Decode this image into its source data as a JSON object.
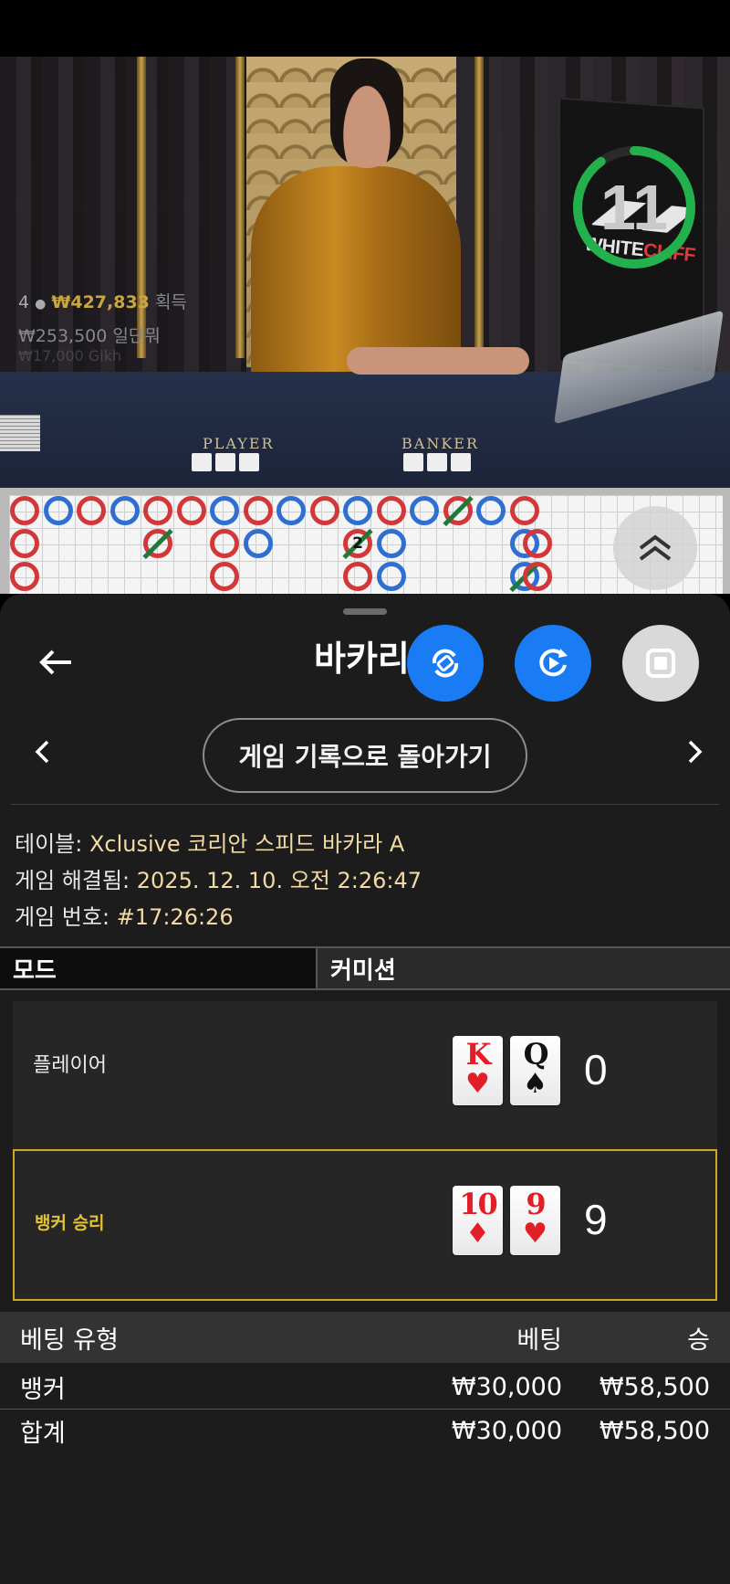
{
  "video": {
    "timer": "11",
    "timer_progress": 0.9,
    "brand_white": "WHITE",
    "brand_red": "CLIFF",
    "stats": {
      "players": "4",
      "won_amount": "₩427,833",
      "won_label": "획득",
      "bet_amount": "₩253,500",
      "bet_label": "일단뭐",
      "faded_line": "₩17,000 Gikh"
    },
    "label_player": "PLAYER",
    "label_banker": "BANKER"
  },
  "roadmap": {
    "colors": {
      "banker": "#d2383a",
      "player": "#2e6fd1",
      "tie": "#1f7a3a"
    },
    "tie_count": "2"
  },
  "sheet": {
    "title": "바카리",
    "back_to_history": "게임 기록으로 돌아가기",
    "table_label": "테이블:",
    "table_value": "Xclusive 코리안 스피드 바카라 A",
    "resolved_label": "게임 해결됨:",
    "resolved_value": "2025. 12. 10. 오전 2:26:47",
    "game_no_label": "게임 번호:",
    "game_no_value": "#17:26:26",
    "mode_label": "모드",
    "commission_label": "커미션",
    "player_label": "플레이어",
    "player_cards": [
      {
        "rank": "K",
        "suit": "♥",
        "color": "red"
      },
      {
        "rank": "Q",
        "suit": "♠",
        "color": "black"
      }
    ],
    "player_score": "0",
    "banker_label": "뱅커 승리",
    "banker_cards": [
      {
        "rank": "10",
        "suit": "♦",
        "color": "red"
      },
      {
        "rank": "9",
        "suit": "♥",
        "color": "red"
      }
    ],
    "banker_score": "9",
    "bets": {
      "headers": {
        "type": "베팅 유형",
        "bet": "베팅",
        "win": "승"
      },
      "rows": [
        {
          "type": "뱅커",
          "bet": "₩30,000",
          "win": "₩58,500"
        }
      ],
      "total": {
        "type": "합계",
        "bet": "₩30,000",
        "win": "₩58,500"
      }
    }
  },
  "accent": {
    "blue": "#1a7cf5",
    "gold": "#c9a82b",
    "win_text": "#e4c234"
  }
}
